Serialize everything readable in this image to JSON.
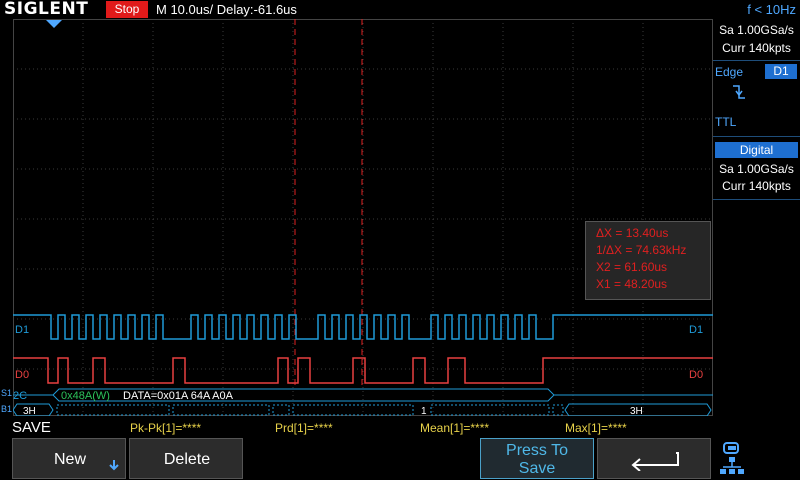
{
  "header": {
    "brand": "SIGLENT",
    "status": "Stop",
    "timebase": "M 10.0us/  Delay:-61.6us",
    "trigger_freq": "f < 10Hz"
  },
  "right_panel": {
    "sample_rate": "Sa 1.00GSa/s",
    "memory": "Curr 140kpts",
    "trigger_type": "Edge",
    "trigger_source": "D1",
    "trigger_level": "TTL",
    "digital_title": "Digital",
    "digital_rate": "Sa 1.00GSa/s",
    "digital_memory": "Curr 140kpts"
  },
  "cursors": {
    "dx": "ΔX = 13.40us",
    "inv_dx": "1/ΔX = 74.63kHz",
    "x2": "X2 = 61.60us",
    "x1": "X1 = 48.20us"
  },
  "channels": {
    "d1_label": "D1",
    "d0_label": "D0",
    "bus_label": "I2C",
    "bus_side_label_1": "S1",
    "bus_side_label_2": "B1"
  },
  "decode": {
    "address": "0x48A(W)",
    "data": "DATA=0x01A 64A A0A",
    "left_value": "3H",
    "marker": "1",
    "right_value": "3H"
  },
  "measurements": {
    "menu_title": "SAVE",
    "pkpk": "Pk-Pk[1]=****",
    "prd": "Prd[1]=****",
    "mean": "Mean[1]=****",
    "max": "Max[1]=****"
  },
  "softkeys": {
    "new_label": "New",
    "delete_label": "Delete",
    "press_to_save_line1": "Press To",
    "press_to_save_line2": "Save"
  },
  "colors": {
    "d1": "#1f9bd8",
    "d0": "#e84040",
    "trigger": "#4fa8ff",
    "cursor": "#e02020",
    "measure": "#e8d24a"
  }
}
